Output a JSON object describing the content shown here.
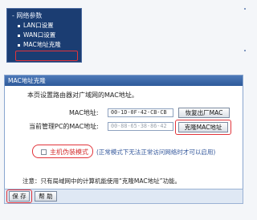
{
  "nav": {
    "heading": "- 网络参数",
    "items": [
      "LAN口设置",
      "WAN口设置",
      "MAC地址克隆"
    ]
  },
  "panel": {
    "title": "MAC地址克隆",
    "intro": "本页设置路由器对广域网的MAC地址。",
    "mac_label": "MAC地址:",
    "mac_value": "00-1D-0F-42-CB-CB",
    "restore_button": "恢复出厂MAC",
    "pc_mac_label": "当前管理PC的MAC地址:",
    "pc_mac_value": "00-88-65-38-86-42",
    "clone_button": "克隆MAC地址",
    "spoof_label": "主机伪装模式",
    "spoof_note": "(正常模式下无法正常访问网络时才可以启用)",
    "note": "注意：只有局域网中的计算机能使用“克隆MAC地址”功能。"
  },
  "footer": {
    "save_button": "保 存",
    "help_button": "帮 助"
  },
  "colors": {
    "nav_bg": "#1b3d72",
    "title_bar": "#3a67a8",
    "highlight": "#e2343a"
  }
}
